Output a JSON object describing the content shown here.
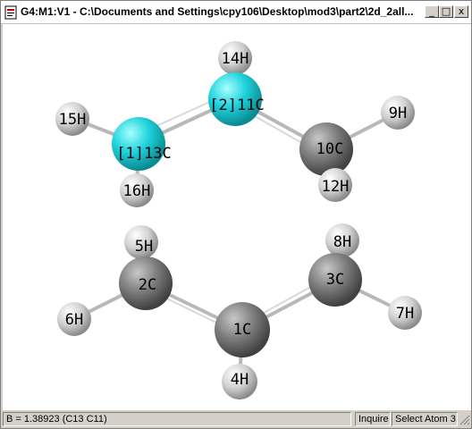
{
  "window": {
    "title": "G4:M1:V1 - C:\\Documents and Settings\\cpy106\\Desktop\\mod3\\part2\\2d_2all...",
    "controls": {
      "minimize": "_",
      "maximize": "□",
      "close": "x"
    }
  },
  "molecule": {
    "atoms": [
      {
        "id": "14H",
        "label": "14H",
        "element": "H"
      },
      {
        "id": "11C",
        "label": "[2]11C",
        "element": "C",
        "selected": true
      },
      {
        "id": "15H",
        "label": "15H",
        "element": "H"
      },
      {
        "id": "13C",
        "label": "[1]13C",
        "element": "C",
        "selected": true
      },
      {
        "id": "10C",
        "label": "10C",
        "element": "C"
      },
      {
        "id": "9H",
        "label": "9H",
        "element": "H"
      },
      {
        "id": "16H",
        "label": "16H",
        "element": "H"
      },
      {
        "id": "12H",
        "label": "12H",
        "element": "H"
      },
      {
        "id": "5H",
        "label": "5H",
        "element": "H"
      },
      {
        "id": "8H",
        "label": "8H",
        "element": "H"
      },
      {
        "id": "2C",
        "label": "2C",
        "element": "C"
      },
      {
        "id": "3C",
        "label": "3C",
        "element": "C"
      },
      {
        "id": "6H",
        "label": "6H",
        "element": "H"
      },
      {
        "id": "7H",
        "label": "7H",
        "element": "H"
      },
      {
        "id": "1C",
        "label": "1C",
        "element": "C"
      },
      {
        "id": "4H",
        "label": "4H",
        "element": "H"
      }
    ],
    "colors": {
      "carbon": "#7f7f7f",
      "hydrogen": "#d8d8d8",
      "selected": "#1ec8d0",
      "bond": "#a0a0a0"
    }
  },
  "status": {
    "measurement": "B = 1.38923 (C13 C11)",
    "mode": "Inquire",
    "action": "Select Atom 3"
  }
}
